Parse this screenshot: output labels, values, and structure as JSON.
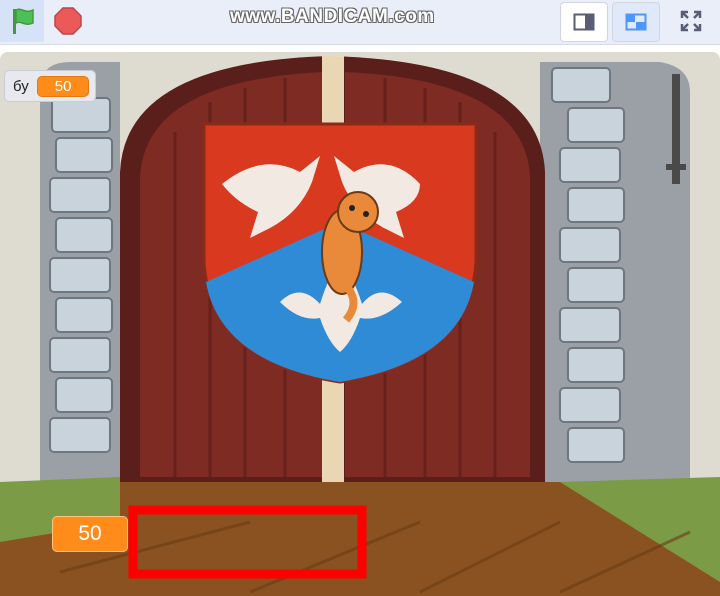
{
  "toolbar": {
    "watermark": "www.BANDICAM.com",
    "icons": [
      "green-flag-icon",
      "stop-sign-icon",
      "small-stage-icon",
      "large-stage-icon",
      "fullscreen-icon"
    ]
  },
  "variable_monitor": {
    "label": "бу",
    "value": "50"
  },
  "large_readout": {
    "value": "50"
  },
  "colors": {
    "accent": "#ff8c1a",
    "highlight_box": "#ff0000",
    "door": "#7a2a22",
    "sky": "#dcdcd2"
  }
}
